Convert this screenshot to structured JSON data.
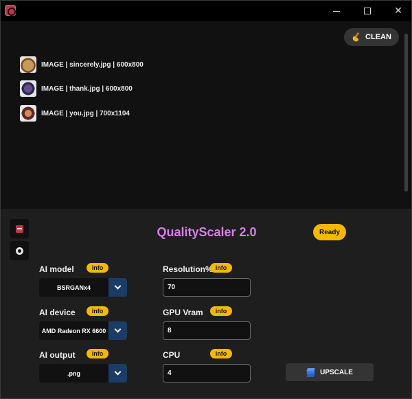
{
  "window": {
    "icons": {
      "app": "app-icon",
      "minimize": "minimize-icon",
      "maximize": "maximize-icon",
      "close": "close-icon"
    }
  },
  "file_list": {
    "clean_label": "CLEAN",
    "files": [
      {
        "label": "IMAGE | sincerely.jpg | 600x800"
      },
      {
        "label": "IMAGE | thank.jpg | 600x800"
      },
      {
        "label": "IMAGE | you.jpg | 700x1104"
      }
    ]
  },
  "panel": {
    "title": "QualityScaler 2.0",
    "status": "Ready",
    "info_label": "info",
    "ai_model": {
      "label": "AI model",
      "value": "BSRGANx4"
    },
    "ai_device": {
      "label": "AI device",
      "value": "AMD Radeon RX 6600"
    },
    "ai_output": {
      "label": "AI output",
      "value": ".png"
    },
    "resolution": {
      "label": "Resolution%",
      "value": "70"
    },
    "gpu_vram": {
      "label": "GPU Vram",
      "value": "8"
    },
    "cpu": {
      "label": "CPU",
      "value": "4"
    },
    "upscale_label": "UPSCALE"
  },
  "colors": {
    "accent_yellow": "#f5b800",
    "title_purple": "#d97fe8",
    "dropdown_blue": "#1b3c66",
    "panel_bg": "#1e1e1e"
  }
}
